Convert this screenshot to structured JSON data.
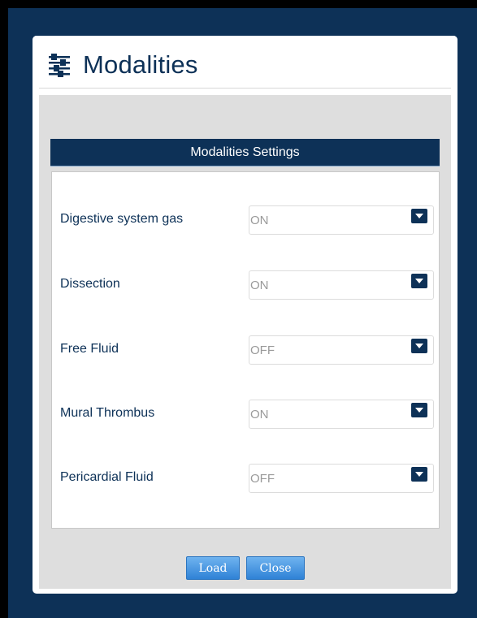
{
  "dialog": {
    "title": "Modalities",
    "icon": "sliders-icon",
    "accent_color": "#0d3157"
  },
  "settings": {
    "header": "Modalities Settings",
    "rows": [
      {
        "label": "Digestive system gas",
        "value": "ON"
      },
      {
        "label": "Dissection",
        "value": "ON"
      },
      {
        "label": "Free Fluid",
        "value": "OFF"
      },
      {
        "label": "Mural Thrombus",
        "value": "ON"
      },
      {
        "label": "Pericardial Fluid",
        "value": "OFF"
      }
    ]
  },
  "buttons": {
    "load": "Load",
    "close": "Close",
    "color": "#3a8fe0"
  }
}
